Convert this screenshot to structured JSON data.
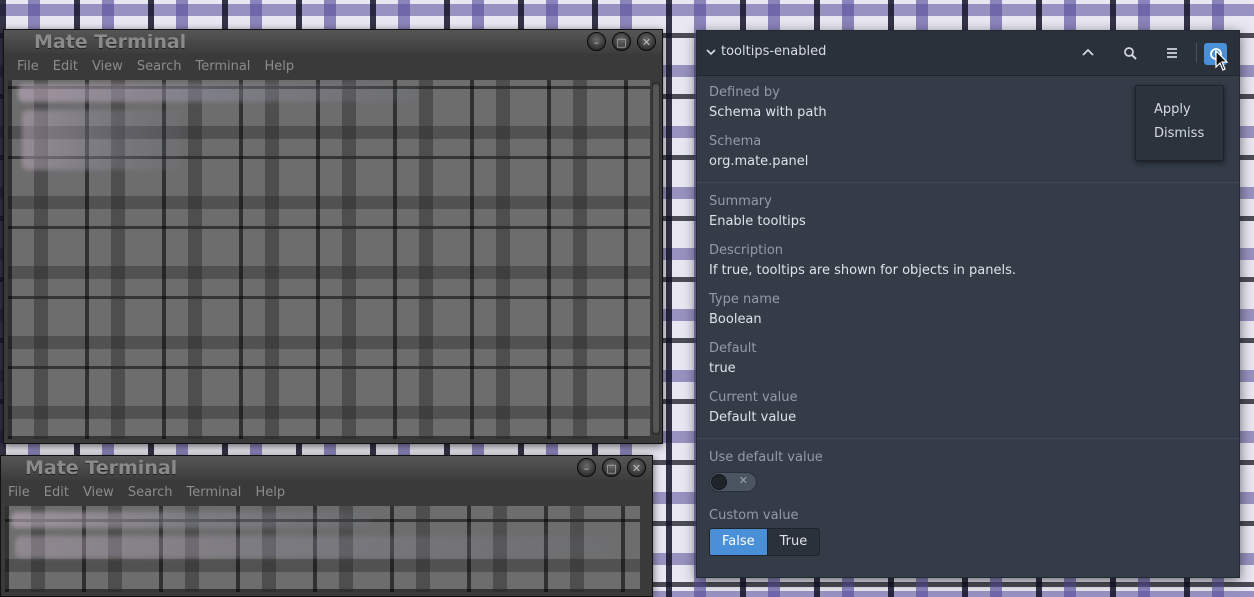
{
  "terminal_top": {
    "title": "Mate Terminal",
    "menu": [
      "File",
      "Edit",
      "View",
      "Search",
      "Terminal",
      "Help"
    ]
  },
  "terminal_bottom": {
    "title": "Mate Terminal",
    "menu": [
      "File",
      "Edit",
      "View",
      "Search",
      "Terminal",
      "Help"
    ]
  },
  "dconf": {
    "key_name": "tooltips-enabled",
    "header_icons": [
      "chevron-up-icon",
      "search-icon",
      "hamburger-menu-icon",
      "apply-options-icon"
    ],
    "popover": {
      "apply": "Apply",
      "dismiss": "Dismiss"
    },
    "defined_by": {
      "label": "Defined by",
      "value": "Schema with path"
    },
    "schema": {
      "label": "Schema",
      "value": "org.mate.panel"
    },
    "summary": {
      "label": "Summary",
      "value": "Enable tooltips"
    },
    "description": {
      "label": "Description",
      "value": "If true, tooltips are shown for objects in panels."
    },
    "type_name": {
      "label": "Type name",
      "value": "Boolean"
    },
    "default": {
      "label": "Default",
      "value": "true"
    },
    "current_value": {
      "label": "Current value",
      "value": "Default value"
    },
    "use_default": {
      "label": "Use default value",
      "state": "off"
    },
    "custom_value": {
      "label": "Custom value",
      "options": [
        "False",
        "True"
      ],
      "selected": "False"
    }
  },
  "colors": {
    "accent": "#4a90d9",
    "panel_bg": "#343c48",
    "header_bg": "#2b313b",
    "terminal_chrome": "#3a3a3a"
  }
}
